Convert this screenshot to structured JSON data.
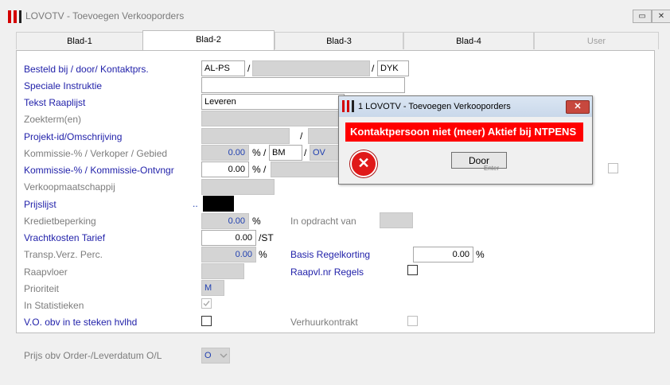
{
  "window": {
    "title": "LOVOTV - Toevoegen Verkooporders",
    "minimize": "▭",
    "close": "✕"
  },
  "tabs": [
    {
      "label": "Blad-1"
    },
    {
      "label": "Blad-2"
    },
    {
      "label": "Blad-3"
    },
    {
      "label": "Blad-4"
    },
    {
      "label": "User"
    }
  ],
  "form": {
    "besteld_label": "Besteld bij / door/ Kontaktprs.",
    "besteld_value1": "AL-PS",
    "besteld_value3": "DYK",
    "speciale_label": "Speciale Instruktie",
    "tekst_label": "Tekst Raaplijst",
    "tekst_value": "Leveren",
    "zoekterm_label": "Zoekterm(en)",
    "projekt_label": "Projekt-id/Omschrijving",
    "kommissie_label": "Kommissie-% / Verkoper / Gebied",
    "kommissie_pct": "0.00",
    "kommissie_verkoper": "BM",
    "kommissie_gebied": "OV",
    "kommissie2_label": "Kommissie-% / Kommissie-Ontvngr",
    "kommissie2_pct": "0.00",
    "verkoopmaatschappij_label": "Verkoopmaatschappij",
    "prijslijst_label": "Prijslijst",
    "prijslijst_dots": "..",
    "krediet_label": "Kredietbeperking",
    "krediet_value": "0.00",
    "opdracht_label": "In opdracht van",
    "vracht_label": "Vrachtkosten Tarief",
    "vracht_value": "0.00",
    "vracht_unit": "/ST",
    "transp_label": "Transp.Verz. Perc.",
    "transp_value": "0.00",
    "basis_label": "Basis Regelkorting",
    "basis_value": "0.00",
    "raapvloer_label": "Raapvloer",
    "raapvl_regels_label": "Raapvl.nr Regels",
    "prioriteit_label": "Prioriteit",
    "prioriteit_value": "M",
    "statistieken_label": "In Statistieken",
    "vo_label": "V.O. obv in te steken hvlhd",
    "verhuur_label": "Verhuurkontrakt",
    "prijs_label": "Prijs obv Order-/Leverdatum O/L",
    "prijs_value": "O",
    "slash": "/",
    "pct": "%"
  },
  "dialog": {
    "title": "1 LOVOTV - Toevoegen Verkooporders",
    "close": "✕",
    "message": "Kontaktpersoon niet (meer) Aktief bij NTPENS",
    "button": "Door",
    "button_hint": "Enter",
    "error_glyph": "✕"
  },
  "colors": {
    "label_blue": "#2222aa",
    "label_grey": "#7c7c7c",
    "error_red": "#ff0000"
  }
}
